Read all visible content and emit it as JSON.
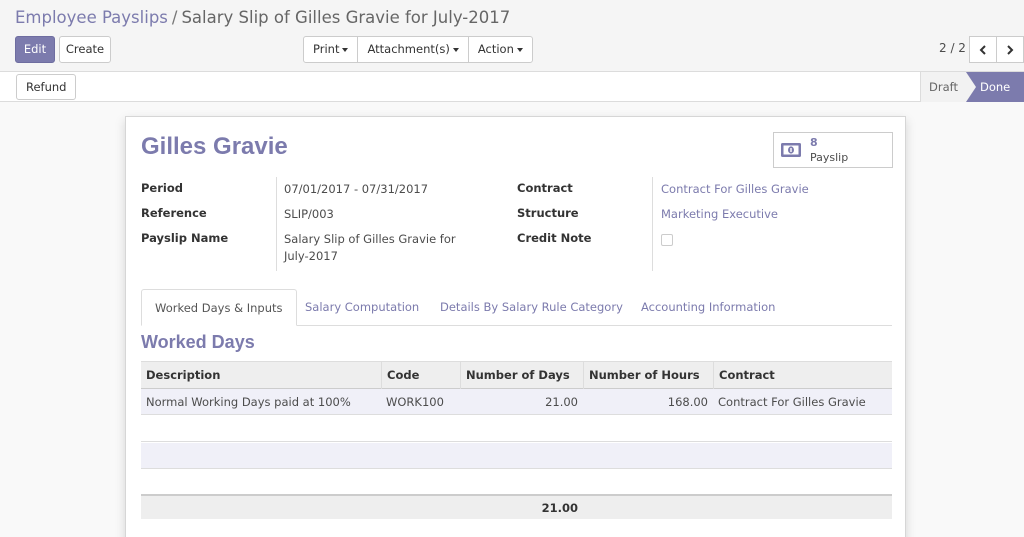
{
  "breadcrumb": {
    "parent": "Employee Payslips",
    "separator": "/",
    "current": "Salary Slip of Gilles Gravie for July-2017"
  },
  "toolbar": {
    "edit_label": "Edit",
    "create_label": "Create",
    "print_label": "Print",
    "attachments_label": "Attachment(s)",
    "action_label": "Action"
  },
  "pager": {
    "value": "2 / 2",
    "prev_icon": "chevron-left-icon",
    "next_icon": "chevron-right-icon"
  },
  "statusbar": {
    "refund_label": "Refund",
    "stages": [
      "Draft",
      "Done"
    ],
    "active_stage": "Done"
  },
  "colors": {
    "accent": "#7c7bad",
    "accent_text": "#ffffff"
  },
  "record": {
    "employee_name": "Gilles Gravie",
    "smart_button": {
      "count": "8",
      "label": "Payslip",
      "icon": "money-icon"
    },
    "left_fields": [
      {
        "label": "Period",
        "value": "07/01/2017 - 07/31/2017"
      },
      {
        "label": "Reference",
        "value": "SLIP/003"
      },
      {
        "label": "Payslip Name",
        "value_line1": "Salary Slip of Gilles Gravie for",
        "value_line2": "July-2017"
      }
    ],
    "right_fields": [
      {
        "label": "Contract",
        "value": "Contract For Gilles Gravie"
      },
      {
        "label": "Structure",
        "value": "Marketing Executive"
      },
      {
        "label": "Credit Note",
        "checked": false
      }
    ]
  },
  "tabs": [
    {
      "label": "Worked Days & Inputs",
      "active": true
    },
    {
      "label": "Salary Computation",
      "active": false
    },
    {
      "label": "Details By Salary Rule Category",
      "active": false
    },
    {
      "label": "Accounting Information",
      "active": false
    }
  ],
  "worked_days": {
    "title": "Worked Days",
    "columns": [
      "Description",
      "Code",
      "Number of Days",
      "Number of Hours",
      "Contract"
    ],
    "rows": [
      {
        "description": "Normal Working Days paid at 100%",
        "code": "WORK100",
        "days": "21.00",
        "hours": "168.00",
        "contract": "Contract For Gilles Gravie"
      }
    ],
    "total_days": "21.00"
  }
}
